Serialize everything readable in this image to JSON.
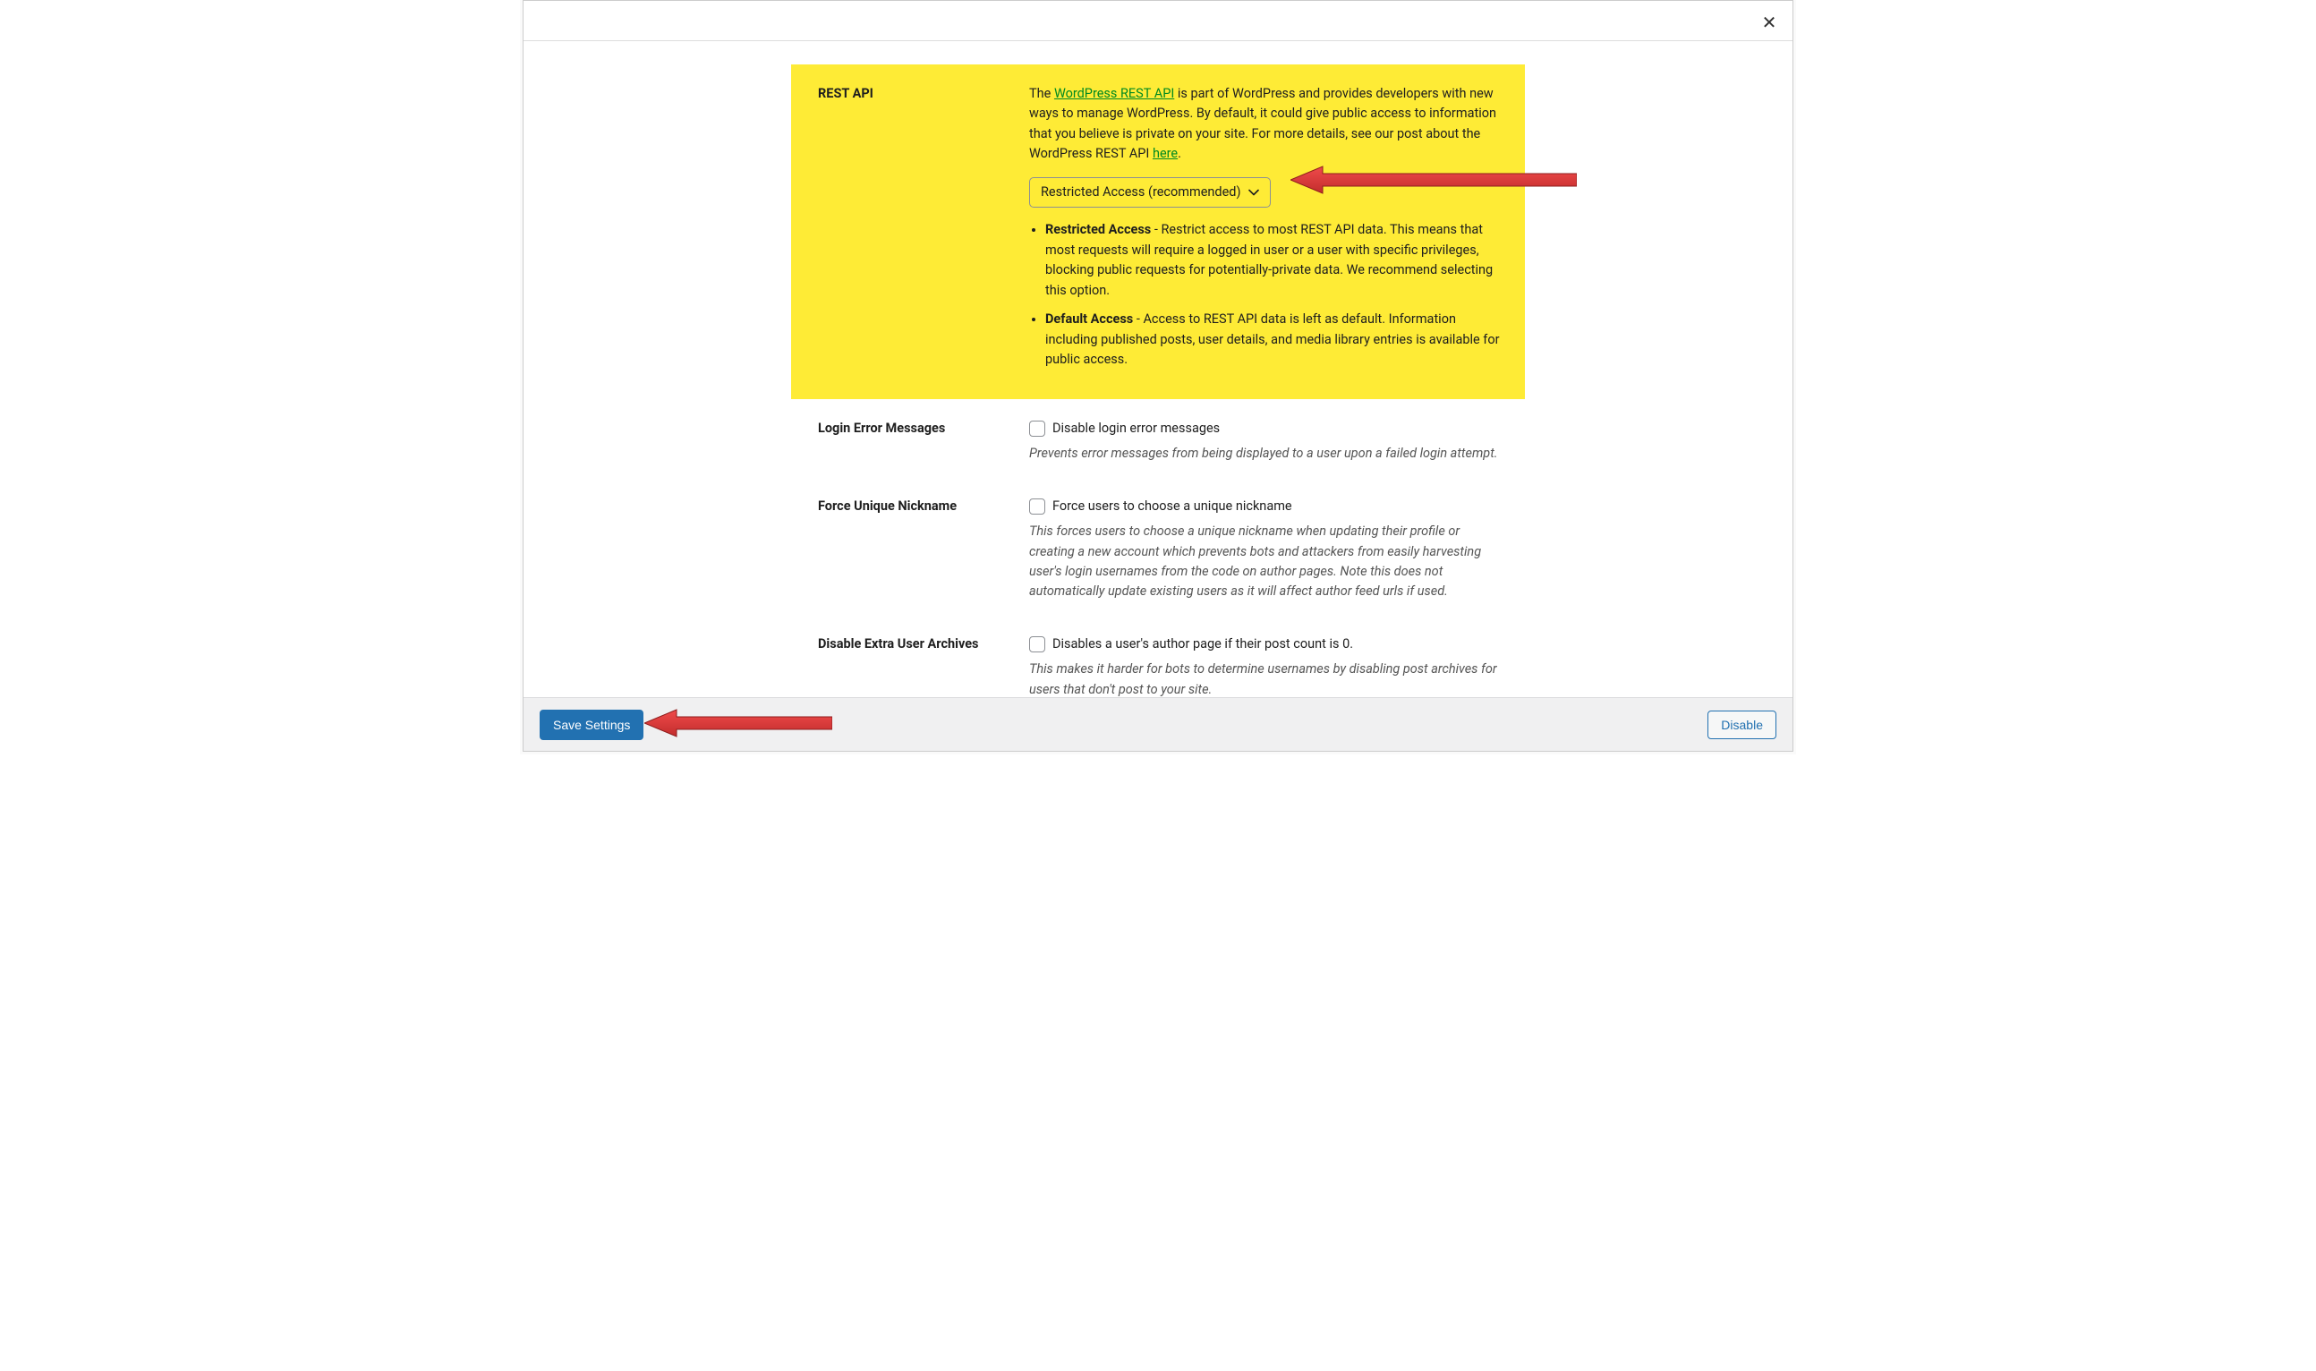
{
  "close_icon_glyph": "✕",
  "rest_api": {
    "label": "REST API",
    "intro_pre": "The ",
    "link1_text": "WordPress REST API",
    "intro_mid": " is part of WordPress and provides developers with new ways to manage WordPress. By default, it could give public access to information that you believe is private on your site. For more details, see our post about the WordPress REST API ",
    "link2_text": "here",
    "intro_post": ".",
    "select_value": "Restricted Access (recommended)",
    "opt_restricted_title": "Restricted Access",
    "opt_restricted_body": " - Restrict access to most REST API data. This means that most requests will require a logged in user or a user with specific privileges, blocking public requests for potentially-private data. We recommend selecting this option.",
    "opt_default_title": "Default Access",
    "opt_default_body": " - Access to REST API data is left as default. Information including published posts, user details, and media library entries is available for public access."
  },
  "login_errors": {
    "label": "Login Error Messages",
    "checkbox_label": "Disable login error messages",
    "help": "Prevents error messages from being displayed to a user upon a failed login attempt."
  },
  "unique_nick": {
    "label": "Force Unique Nickname",
    "checkbox_label": "Force users to choose a unique nickname",
    "help": "This forces users to choose a unique nickname when updating their profile or creating a new account which prevents bots and attackers from easily harvesting user's login usernames from the code on author pages. Note this does not automatically update existing users as it will affect author feed urls if used."
  },
  "extra_archives": {
    "label": "Disable Extra User Archives",
    "checkbox_label": "Disables a user's author page if their post count is 0.",
    "help": "This makes it harder for bots to determine usernames by disabling post archives for users that don't post to your site."
  },
  "footer": {
    "save": "Save Settings",
    "disable": "Disable"
  }
}
